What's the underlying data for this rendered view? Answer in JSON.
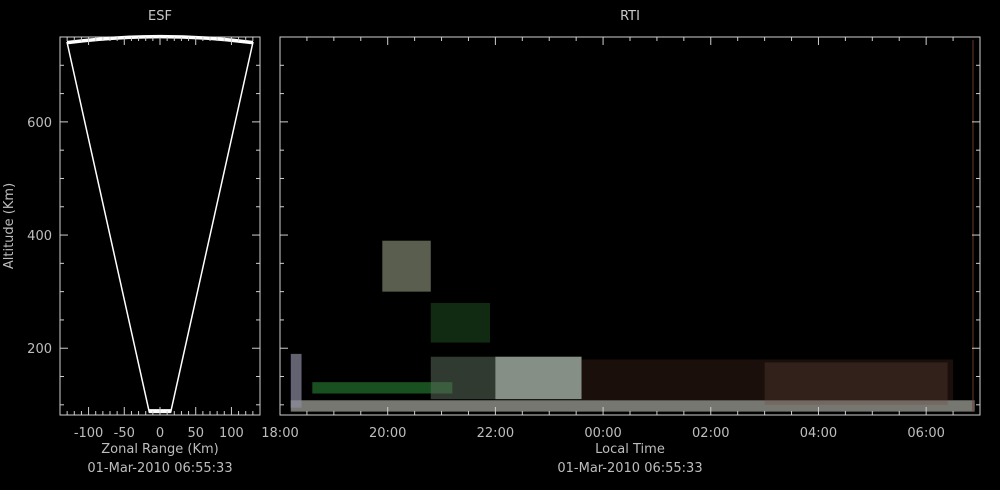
{
  "chart_data": [
    {
      "type": "other",
      "title": "ESF",
      "xlabel": "Zonal Range (Km)",
      "ylabel": "Altitude (Km)",
      "timestamp": "01-Mar-2010 06:55:33",
      "xlim": [
        -140,
        140
      ],
      "ylim": [
        82,
        750
      ],
      "x_ticks": [
        -100,
        -50,
        0,
        50,
        100
      ],
      "y_ticks": [
        200,
        400,
        600
      ],
      "beam_fan": {
        "apex_altitude": 87,
        "top_altitude": 740,
        "left_top_x": -130,
        "right_top_x": 130,
        "left_bottom_x": -15,
        "right_bottom_x": 15,
        "color": "#ffffff"
      }
    },
    {
      "type": "heatmap",
      "title": "RTI",
      "xlabel": "Local Time",
      "timestamp": "01-Mar-2010 06:55:33",
      "ylim": [
        82,
        750
      ],
      "x_ticks": [
        "18:00",
        "20:00",
        "22:00",
        "00:00",
        "02:00",
        "04:00",
        "06:00"
      ],
      "x_tick_hours": [
        18,
        20,
        22,
        24,
        26,
        28,
        30
      ],
      "xlim_hours": [
        18,
        31
      ],
      "y_ticks": [
        200,
        400,
        600
      ],
      "echo_regions": [
        {
          "t0": 18.2,
          "t1": 30.9,
          "h0": 88,
          "h1": 108,
          "color": "#d9d9d0",
          "opacity": 0.55
        },
        {
          "t0": 18.2,
          "t1": 18.4,
          "h0": 95,
          "h1": 190,
          "color": "#8c8ca0",
          "opacity": 0.7
        },
        {
          "t0": 19.9,
          "t1": 20.8,
          "h0": 300,
          "h1": 390,
          "color": "#c8d0b0",
          "opacity": 0.45
        },
        {
          "t0": 20.8,
          "t1": 21.9,
          "h0": 210,
          "h1": 280,
          "color": "#2f7a35",
          "opacity": 0.35
        },
        {
          "t0": 18.6,
          "t1": 21.2,
          "h0": 120,
          "h1": 140,
          "color": "#2fa040",
          "opacity": 0.5
        },
        {
          "t0": 20.8,
          "t1": 23.6,
          "h0": 110,
          "h1": 185,
          "color": "#5a6a5a",
          "opacity": 0.55
        },
        {
          "t0": 22.0,
          "t1": 23.6,
          "h0": 110,
          "h1": 185,
          "color": "#c0c8c0",
          "opacity": 0.6
        },
        {
          "t0": 23.6,
          "t1": 30.5,
          "h0": 108,
          "h1": 180,
          "color": "#4a2a20",
          "opacity": 0.35
        },
        {
          "t0": 27.0,
          "t1": 30.4,
          "h0": 100,
          "h1": 175,
          "color": "#6a4a40",
          "opacity": 0.3
        }
      ]
    }
  ]
}
